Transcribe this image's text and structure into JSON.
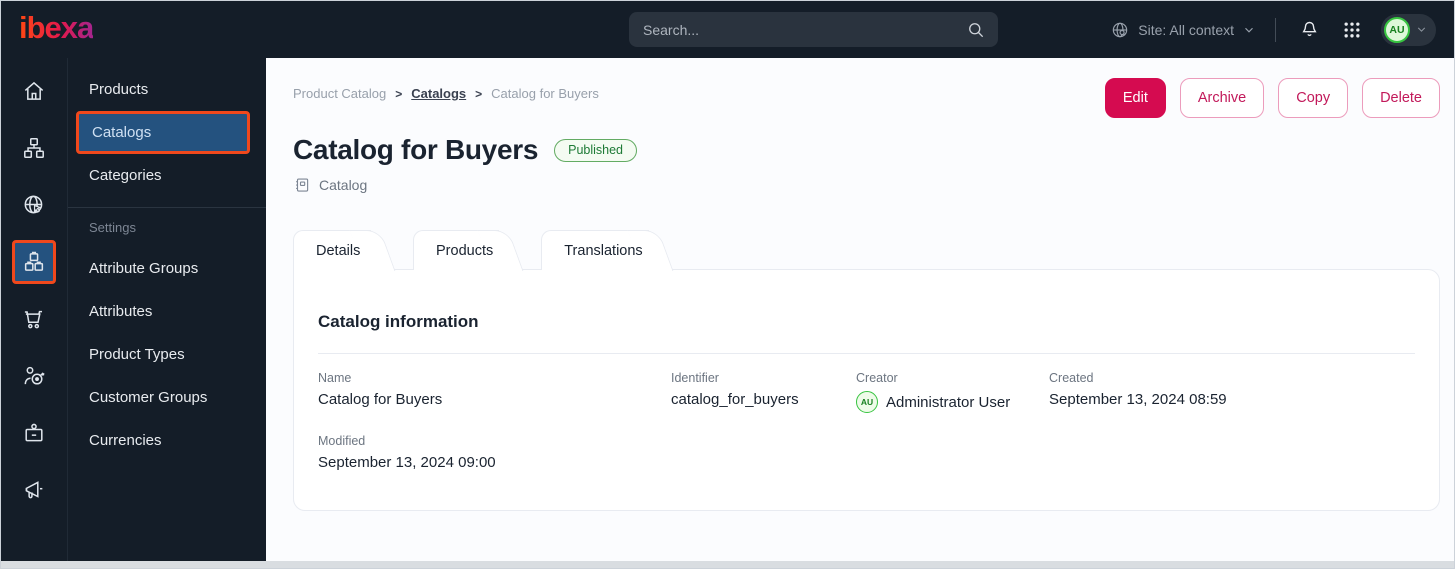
{
  "topbar": {
    "logo": "ibexa",
    "search_placeholder": "Search...",
    "site_context": "Site: All context",
    "avatar_initials": "AU"
  },
  "iconbar": {
    "items": [
      "home",
      "content-tree",
      "site",
      "product-catalog",
      "commerce",
      "personalization",
      "admin",
      "marketing"
    ],
    "active_item": "product-catalog"
  },
  "sidebar": {
    "items": [
      "Products",
      "Catalogs",
      "Categories"
    ],
    "active_item": "Catalogs",
    "settings_heading": "Settings",
    "settings_items": [
      "Attribute Groups",
      "Attributes",
      "Product Types",
      "Customer Groups",
      "Currencies"
    ]
  },
  "breadcrumb": {
    "separator": ">",
    "items": [
      "Product Catalog",
      "Catalogs",
      "Catalog for Buyers"
    ]
  },
  "actions": {
    "edit": "Edit",
    "archive": "Archive",
    "copy": "Copy",
    "delete": "Delete"
  },
  "header": {
    "title": "Catalog for Buyers",
    "status": "Published",
    "type_label": "Catalog"
  },
  "tabs": [
    {
      "label": "Details",
      "active": true
    },
    {
      "label": "Products",
      "active": false
    },
    {
      "label": "Translations",
      "active": false
    }
  ],
  "card": {
    "title": "Catalog information",
    "fields": {
      "name": {
        "label": "Name",
        "value": "Catalog for Buyers"
      },
      "identifier": {
        "label": "Identifier",
        "value": "catalog_for_buyers"
      },
      "creator": {
        "label": "Creator",
        "value": "Administrator User",
        "avatar_initials": "AU"
      },
      "created": {
        "label": "Created",
        "value": "September 13, 2024 08:59"
      },
      "modified": {
        "label": "Modified",
        "value": "September 13, 2024 09:00"
      }
    }
  },
  "colors": {
    "accent_pink": "#d50b50",
    "highlight_orange": "#f0481c",
    "active_blue": "#24527f",
    "published_green": "#1d7a35",
    "dark_bg": "#141d28"
  }
}
